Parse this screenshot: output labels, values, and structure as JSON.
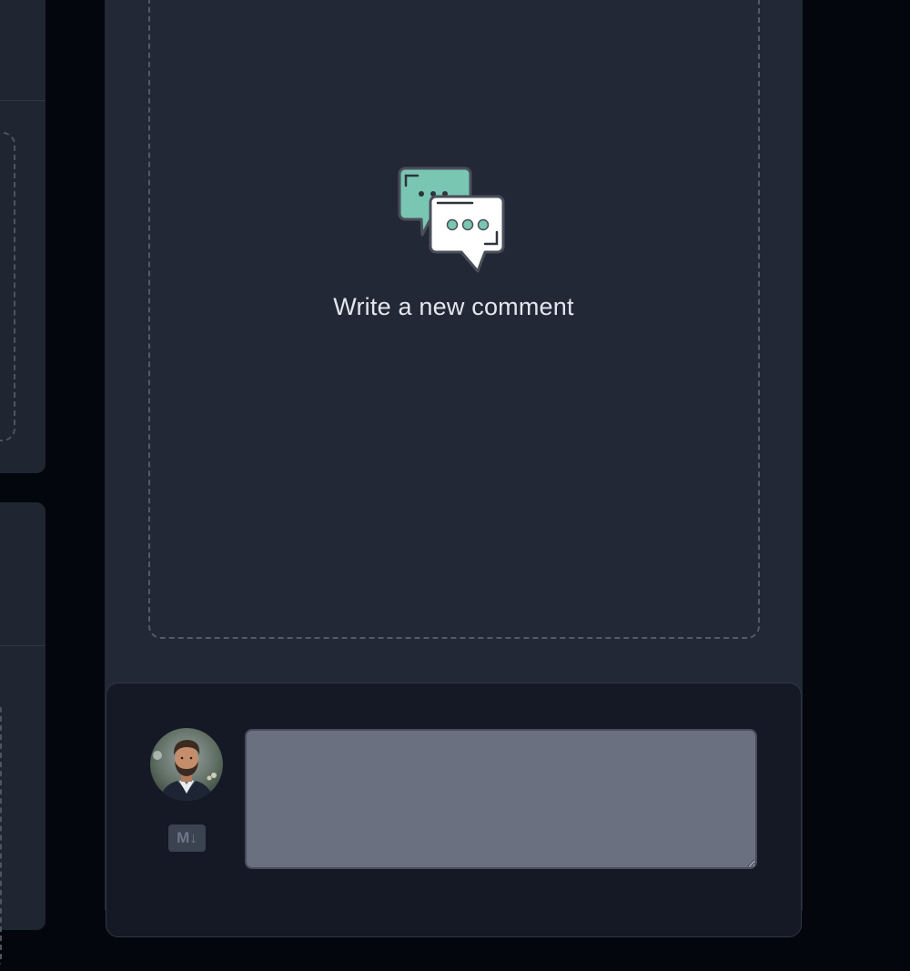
{
  "empty_state": {
    "message": "Write a new comment",
    "icon": "chat-bubbles-icon",
    "colors": {
      "bubble_back": "#79c6b2",
      "bubble_front": "#ffffff",
      "outline": "#4a4f59"
    }
  },
  "composer": {
    "avatar": "user-avatar",
    "markdown_badge": "M↓",
    "input_value": "",
    "input_placeholder": ""
  },
  "colors": {
    "page_background": "#04060d",
    "panel_background": "#222836",
    "composer_background": "#141925",
    "input_background": "#6b7080"
  }
}
